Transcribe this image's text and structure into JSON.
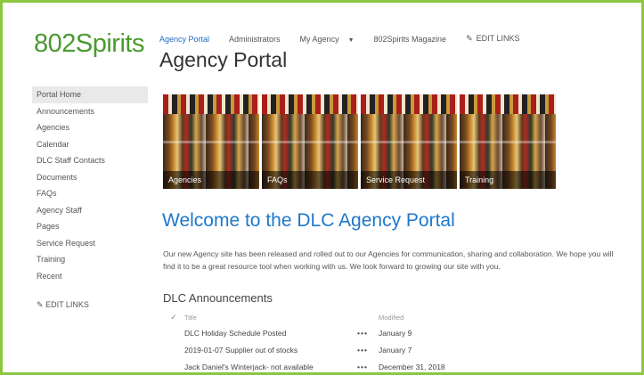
{
  "brand": {
    "logo_text": "802Spirits"
  },
  "topnav": {
    "items": [
      {
        "label": "Agency Portal"
      },
      {
        "label": "Administrators"
      },
      {
        "label": "My Agency",
        "dropdown_icon": "triangle-down"
      },
      {
        "label": "802Spirits Magazine"
      }
    ],
    "edit_links": {
      "label": "EDIT LINKS",
      "icon": "pencil"
    }
  },
  "page": {
    "title": "Agency Portal"
  },
  "leftnav": {
    "items": [
      {
        "label": "Portal Home",
        "selected": true
      },
      {
        "label": "Announcements"
      },
      {
        "label": "Agencies"
      },
      {
        "label": "Calendar"
      },
      {
        "label": "DLC Staff Contacts"
      },
      {
        "label": "Documents"
      },
      {
        "label": "FAQs"
      },
      {
        "label": "Agency Staff"
      },
      {
        "label": "Pages"
      },
      {
        "label": "Service Request"
      },
      {
        "label": "Training"
      },
      {
        "label": "Recent"
      }
    ],
    "edit_links": {
      "label": "EDIT LINKS",
      "icon": "pencil"
    }
  },
  "tiles": [
    {
      "label": "Agencies"
    },
    {
      "label": "FAQs"
    },
    {
      "label": "Service Request"
    },
    {
      "label": "Training"
    }
  ],
  "welcome": {
    "heading": "Welcome to the DLC Agency Portal",
    "body": "Our new Agency site has been released and rolled out to our Agencies for communication, sharing and collaboration.  We hope you will find it to be a great resource tool when working with us.  We look forward to growing our site with you."
  },
  "announcements": {
    "title": "DLC Announcements",
    "columns": {
      "check": "✓",
      "title": "Title",
      "modified": "Modified"
    },
    "rows": [
      {
        "title": "DLC Holiday Schedule Posted",
        "menu": "•••",
        "modified": "January 9"
      },
      {
        "title": "2019-01-07 Supplier out of stocks",
        "menu": "•••",
        "modified": "January 7"
      },
      {
        "title": "Jack Daniel's Winterjack- not available",
        "menu": "•••",
        "modified": "December 31, 2018"
      }
    ]
  },
  "colors": {
    "accent_blue": "#1f78c9",
    "brand_green": "#4a9b2f",
    "frame_green": "#8dc63f"
  }
}
